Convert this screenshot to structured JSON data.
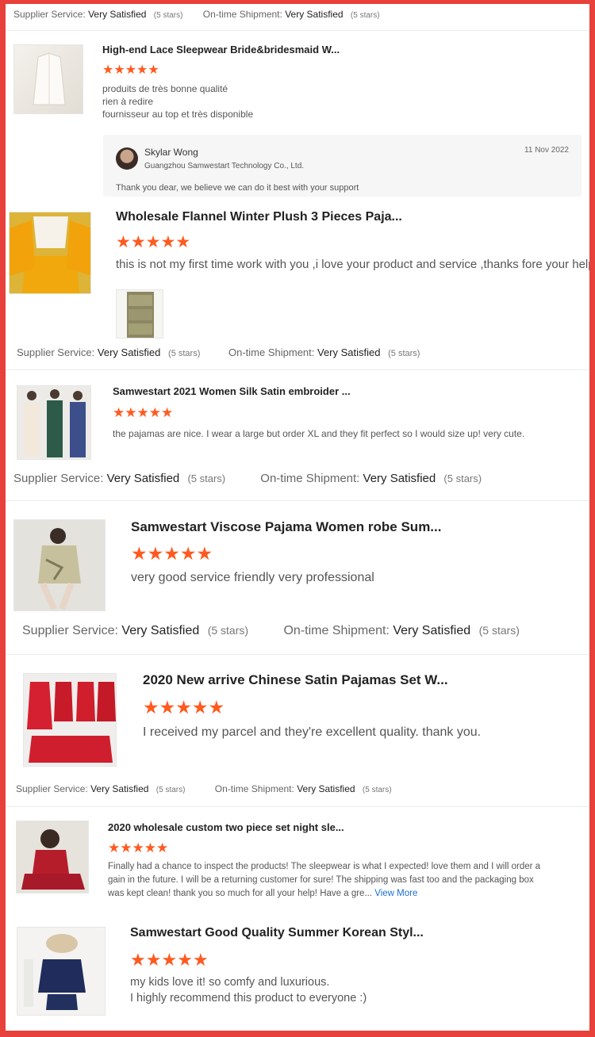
{
  "colors": {
    "accent": "#ff5a1f",
    "frame": "#e8403a",
    "link": "#1a6fd6"
  },
  "labels": {
    "supplier_service": "Supplier Service:",
    "ontime_shipment": "On-time Shipment:",
    "very_satisfied": "Very Satisfied",
    "five_stars": "(5 stars)",
    "view_more": "View More"
  },
  "reviews": [
    {
      "title": "High-end Lace Sleepwear Bride&bridesmaid W...",
      "rating": 5,
      "lines": [
        "produits de très bonne qualité",
        "rien à redire",
        "fournisseur au top et très disponible"
      ],
      "reply": {
        "name": "Skylar Wong",
        "company": "Guangzhou Samwestart Technology Co., Ltd.",
        "date": "11 Nov 2022",
        "text": "Thank you dear, we believe we can do it best with your support"
      }
    },
    {
      "title": "Wholesale Flannel Winter Plush 3 Pieces Paja...",
      "rating": 5,
      "lines": [
        "this is not my first time work with you ,i love your product and service ,thanks fore your help"
      ]
    },
    {
      "title": "Samwestart 2021 Women Silk Satin embroider ...",
      "rating": 5,
      "lines": [
        "the pajamas are nice. I wear a large but order XL and they fit perfect so I would size up! very cute."
      ]
    },
    {
      "title": "Samwestart Viscose Pajama Women robe Sum...",
      "rating": 5,
      "lines": [
        "very good service friendly very professional"
      ]
    },
    {
      "title": "2020 New arrive Chinese Satin Pajamas Set W...",
      "rating": 5,
      "lines": [
        "I received my parcel and they're excellent quality. thank you."
      ]
    },
    {
      "title": "2020 wholesale custom two piece set night sle...",
      "rating": 5,
      "lines": [
        "Finally had a chance to inspect the products! The sleepwear is what I expected! love them and I will order a",
        "gain in the future. I will be a returning customer for sure! The shipping was fast too and the packaging box",
        "was kept clean! thank you so much for all your help! Have a gre..."
      ]
    },
    {
      "title": "Samwestart Good Quality Summer Korean Styl...",
      "rating": 5,
      "lines": [
        "my kids love it! so comfy and luxurious.",
        "I highly recommend this product to everyone :)"
      ]
    }
  ]
}
